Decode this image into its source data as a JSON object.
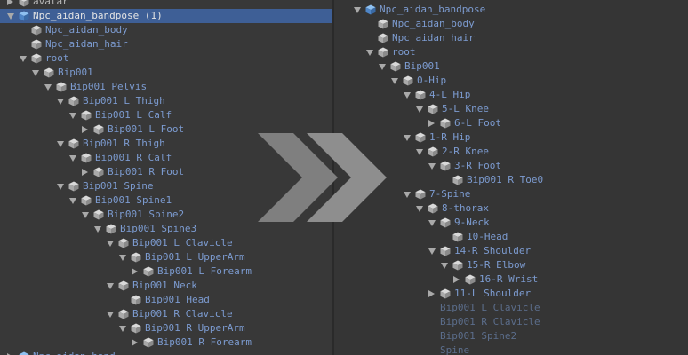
{
  "left_tree": [
    {
      "label": "avatar",
      "depth": 0,
      "arrow": "right",
      "icon": "cube-icon",
      "style": "plain"
    },
    {
      "label": "Npc_aidan_bandpose (1)",
      "depth": 0,
      "arrow": "down",
      "icon": "prefab-icon",
      "style": "white",
      "selected": true
    },
    {
      "label": "Npc_aidan_body",
      "depth": 1,
      "arrow": "none",
      "icon": "cube-icon",
      "style": "blue"
    },
    {
      "label": "Npc_aidan_hair",
      "depth": 1,
      "arrow": "none",
      "icon": "cube-icon",
      "style": "blue"
    },
    {
      "label": "root",
      "depth": 1,
      "arrow": "down",
      "icon": "cube-icon",
      "style": "blue"
    },
    {
      "label": "Bip001",
      "depth": 2,
      "arrow": "down",
      "icon": "cube-icon",
      "style": "blue"
    },
    {
      "label": "Bip001 Pelvis",
      "depth": 3,
      "arrow": "down",
      "icon": "cube-icon",
      "style": "blue"
    },
    {
      "label": "Bip001 L Thigh",
      "depth": 4,
      "arrow": "down",
      "icon": "cube-icon",
      "style": "blue"
    },
    {
      "label": "Bip001 L Calf",
      "depth": 5,
      "arrow": "down",
      "icon": "cube-icon",
      "style": "blue"
    },
    {
      "label": "Bip001 L Foot",
      "depth": 6,
      "arrow": "right",
      "icon": "cube-icon",
      "style": "blue"
    },
    {
      "label": "Bip001 R Thigh",
      "depth": 4,
      "arrow": "down",
      "icon": "cube-icon",
      "style": "blue"
    },
    {
      "label": "Bip001 R Calf",
      "depth": 5,
      "arrow": "down",
      "icon": "cube-icon",
      "style": "blue"
    },
    {
      "label": "Bip001 R Foot",
      "depth": 6,
      "arrow": "right",
      "icon": "cube-icon",
      "style": "blue"
    },
    {
      "label": "Bip001 Spine",
      "depth": 4,
      "arrow": "down",
      "icon": "cube-icon",
      "style": "blue"
    },
    {
      "label": "Bip001 Spine1",
      "depth": 5,
      "arrow": "down",
      "icon": "cube-icon",
      "style": "blue"
    },
    {
      "label": "Bip001 Spine2",
      "depth": 6,
      "arrow": "down",
      "icon": "cube-icon",
      "style": "blue"
    },
    {
      "label": "Bip001 Spine3",
      "depth": 7,
      "arrow": "down",
      "icon": "cube-icon",
      "style": "blue"
    },
    {
      "label": "Bip001 L Clavicle",
      "depth": 8,
      "arrow": "down",
      "icon": "cube-icon",
      "style": "blue"
    },
    {
      "label": "Bip001 L UpperArm",
      "depth": 9,
      "arrow": "down",
      "icon": "cube-icon",
      "style": "blue"
    },
    {
      "label": "Bip001 L Forearm",
      "depth": 10,
      "arrow": "right",
      "icon": "cube-icon",
      "style": "blue"
    },
    {
      "label": "Bip001 Neck",
      "depth": 8,
      "arrow": "down",
      "icon": "cube-icon",
      "style": "blue"
    },
    {
      "label": "Bip001 Head",
      "depth": 9,
      "arrow": "none",
      "icon": "cube-icon",
      "style": "blue"
    },
    {
      "label": "Bip001 R Clavicle",
      "depth": 8,
      "arrow": "down",
      "icon": "cube-icon",
      "style": "blue"
    },
    {
      "label": "Bip001 R UpperArm",
      "depth": 9,
      "arrow": "down",
      "icon": "cube-icon",
      "style": "blue"
    },
    {
      "label": "Bip001 R Forearm",
      "depth": 10,
      "arrow": "right",
      "icon": "cube-icon",
      "style": "blue"
    },
    {
      "label": "Npc_aidan_hand",
      "depth": 0,
      "arrow": "right",
      "icon": "prefab-icon",
      "style": "blue"
    }
  ],
  "right_tree": [
    {
      "label": "Npc_aidan_bandpose",
      "depth": 0,
      "arrow": "down",
      "icon": "prefab-icon",
      "style": "blue"
    },
    {
      "label": "Npc_aidan_body",
      "depth": 1,
      "arrow": "none",
      "icon": "cube-icon",
      "style": "blue"
    },
    {
      "label": "Npc_aidan_hair",
      "depth": 1,
      "arrow": "none",
      "icon": "cube-icon",
      "style": "blue"
    },
    {
      "label": "root",
      "depth": 1,
      "arrow": "down",
      "icon": "cube-icon",
      "style": "blue"
    },
    {
      "label": "Bip001",
      "depth": 2,
      "arrow": "down",
      "icon": "cube-icon",
      "style": "blue"
    },
    {
      "label": "0-Hip",
      "depth": 3,
      "arrow": "down",
      "icon": "cube-icon",
      "style": "blue"
    },
    {
      "label": "4-L Hip",
      "depth": 4,
      "arrow": "down",
      "icon": "cube-icon",
      "style": "blue"
    },
    {
      "label": "5-L Knee",
      "depth": 5,
      "arrow": "down",
      "icon": "cube-icon",
      "style": "blue"
    },
    {
      "label": "6-L Foot",
      "depth": 6,
      "arrow": "right",
      "icon": "cube-icon",
      "style": "blue"
    },
    {
      "label": "1-R Hip",
      "depth": 4,
      "arrow": "down",
      "icon": "cube-icon",
      "style": "blue"
    },
    {
      "label": "2-R Knee",
      "depth": 5,
      "arrow": "down",
      "icon": "cube-icon",
      "style": "blue"
    },
    {
      "label": "3-R Foot",
      "depth": 6,
      "arrow": "down",
      "icon": "cube-icon",
      "style": "blue"
    },
    {
      "label": "Bip001 R Toe0",
      "depth": 7,
      "arrow": "none",
      "icon": "cube-icon",
      "style": "blue"
    },
    {
      "label": "7-Spine",
      "depth": 4,
      "arrow": "down",
      "icon": "cube-icon",
      "style": "blue"
    },
    {
      "label": "8-thorax",
      "depth": 5,
      "arrow": "down",
      "icon": "cube-icon",
      "style": "blue"
    },
    {
      "label": "9-Neck",
      "depth": 6,
      "arrow": "down",
      "icon": "cube-icon",
      "style": "blue"
    },
    {
      "label": "10-Head",
      "depth": 7,
      "arrow": "none",
      "icon": "cube-icon",
      "style": "blue"
    },
    {
      "label": "14-R Shoulder",
      "depth": 6,
      "arrow": "down",
      "icon": "cube-icon",
      "style": "blue"
    },
    {
      "label": "15-R Elbow",
      "depth": 7,
      "arrow": "down",
      "icon": "cube-icon",
      "style": "blue"
    },
    {
      "label": "16-R Wrist",
      "depth": 8,
      "arrow": "right",
      "icon": "cube-icon",
      "style": "blue"
    },
    {
      "label": "11-L Shoulder",
      "depth": 6,
      "arrow": "right",
      "icon": "cube-icon",
      "style": "blue"
    },
    {
      "label": "Bip001 L Clavicle",
      "depth": 6,
      "arrow": "none",
      "icon": "none",
      "style": "dim"
    },
    {
      "label": "Bip001 R Clavicle",
      "depth": 6,
      "arrow": "none",
      "icon": "none",
      "style": "dim"
    },
    {
      "label": "Bip001 Spine2",
      "depth": 6,
      "arrow": "none",
      "icon": "none",
      "style": "dim"
    },
    {
      "label": "Spine",
      "depth": 6,
      "arrow": "none",
      "icon": "none",
      "style": "dim"
    }
  ],
  "colors": {
    "selection": "#3e5f96",
    "label_blue": "#7c9bd0",
    "label_dim": "#5b6d8b",
    "chevron": "#8a8a8a"
  }
}
